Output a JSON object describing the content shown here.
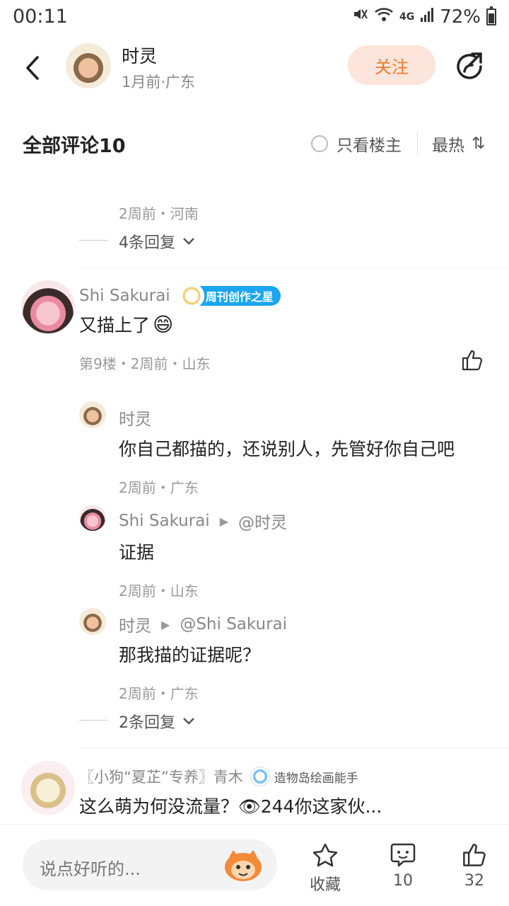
{
  "status_bar": {
    "time": "00:11",
    "network": "4G",
    "battery": "72%"
  },
  "header": {
    "author_name": "时灵",
    "author_meta": "1月前·广东",
    "follow_label": "关注"
  },
  "comments_bar": {
    "title": "全部评论10",
    "only_op_label": "只看楼主",
    "sort_label": "最热",
    "sort_icon": "⇅"
  },
  "prev_comment": {
    "meta": "2周前・河南",
    "expand_label": "4条回复"
  },
  "comment_9": {
    "user": "Shi Sakurai",
    "badge": "周刊创作之星",
    "text": "又描上了",
    "emoji": "😄",
    "meta": "第9楼・2周前・山东",
    "replies": [
      {
        "user": "时灵",
        "target": "",
        "text": "你自己都描的，还说别人，先管好你自己吧",
        "meta": "2周前・广东"
      },
      {
        "user": "Shi Sakurai",
        "target": "@时灵",
        "text": "证据",
        "meta": "2周前・山东"
      },
      {
        "user": "时灵",
        "target": "@Shi Sakurai",
        "text": "那我描的证据呢？",
        "meta": "2周前・广东"
      }
    ],
    "expand_label": "2条回复"
  },
  "comment_next": {
    "user": "〖小狗“夏芷”专养〗青木",
    "badge": "造物岛绘画能手",
    "text": "这么萌为何没流量？👁244你这家伙..."
  },
  "bottom_bar": {
    "input_placeholder": "说点好听的...",
    "collect_label": "收藏",
    "comment_count": "10",
    "like_count": "32"
  },
  "icons": [
    "back-icon",
    "share-icon",
    "radio-icon",
    "sort-icon",
    "chevron-down-icon",
    "thumbs-up-icon",
    "star-icon",
    "comment-icon",
    "mascot-icon"
  ],
  "colors": {
    "accent": "#f07a2a",
    "follow_bg": "#fde5dc",
    "badge_blue": "#1aa6f0"
  }
}
